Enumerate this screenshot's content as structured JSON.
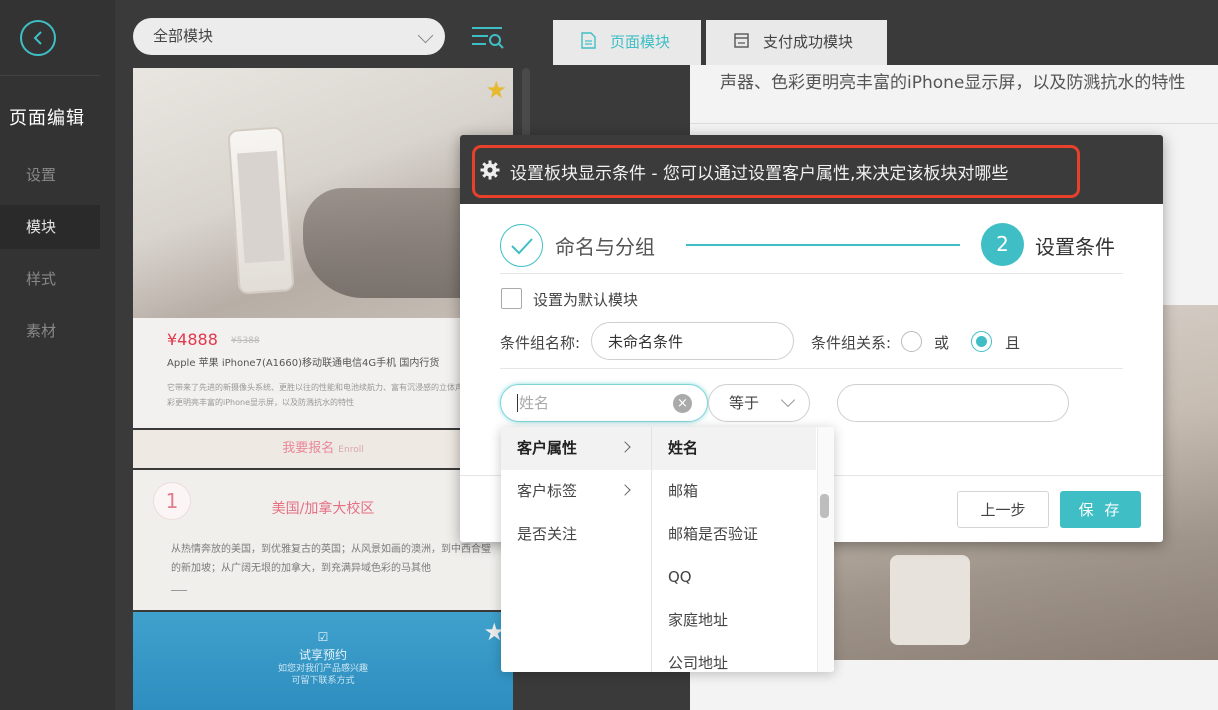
{
  "sidebar": {
    "title": "页面编辑",
    "items": [
      {
        "label": "设置",
        "active": false
      },
      {
        "label": "模块",
        "active": true
      },
      {
        "label": "样式",
        "active": false
      },
      {
        "label": "素材",
        "active": false
      }
    ]
  },
  "modules": {
    "select_value": "全部模块",
    "product_card": {
      "price": "¥4888",
      "old_price": "¥5388",
      "title": "Apple 苹果 iPhone7(A1660)移动联通电信4G手机 国内行货",
      "desc": "它带来了先进的新摄像头系统、更胜以往的性能和电池续航力、富有沉浸感的立体声扬声器、色彩更明亮丰富的iPhone显示屏，以及防溅抗水的特性"
    },
    "signup_card": {
      "label": "我要报名",
      "en": "Enroll"
    },
    "campus_card": {
      "number": "1",
      "title": "美国/加拿大校区",
      "desc": "从热情奔放的美国，到优雅复古的英国；从风景如画的澳洲，到中西合璧的新加坡；从广阔无垠的加拿大，到充满异域色彩的马其他"
    },
    "trial_card": {
      "title": "试享预约",
      "line1": "如您对我们产品感兴趣",
      "line2": "可留下联系方式"
    }
  },
  "preview": {
    "tabs": [
      {
        "label": "页面模块",
        "active": true
      },
      {
        "label": "支付成功模块",
        "active": false
      }
    ],
    "canvas_text": "声器、色彩更明亮丰富的iPhone显示屏，以及防溅抗水的特性"
  },
  "dialog": {
    "title": "设置板块显示条件 - 您可以通过设置客户属性,来决定该板块对哪些",
    "step1": {
      "label": "命名与分组"
    },
    "step2": {
      "number": "2",
      "label": "设置条件"
    },
    "default_checkbox_label": "设置为默认模块",
    "group_name_label": "条件组名称:",
    "group_name_value": "未命名条件",
    "relation_label": "条件组关系:",
    "relation_options": [
      {
        "label": "或",
        "checked": false
      },
      {
        "label": "且",
        "checked": true
      }
    ],
    "attribute_placeholder": "姓名",
    "operator_value": "等于",
    "value_input": "",
    "prev_button": "上一步",
    "save_button": "保 存",
    "accent_color": "#3fbfc5",
    "highlight_color": "#e8412b"
  },
  "cascade": {
    "categories": [
      {
        "label": "客户属性",
        "active": true,
        "has_children": true
      },
      {
        "label": "客户标签",
        "active": false,
        "has_children": true
      },
      {
        "label": "是否关注",
        "active": false,
        "has_children": false
      }
    ],
    "attributes": [
      {
        "label": "姓名",
        "active": true
      },
      {
        "label": "邮箱",
        "active": false
      },
      {
        "label": "邮箱是否验证",
        "active": false
      },
      {
        "label": "QQ",
        "active": false
      },
      {
        "label": "家庭地址",
        "active": false
      },
      {
        "label": "公司地址",
        "active": false
      }
    ]
  }
}
